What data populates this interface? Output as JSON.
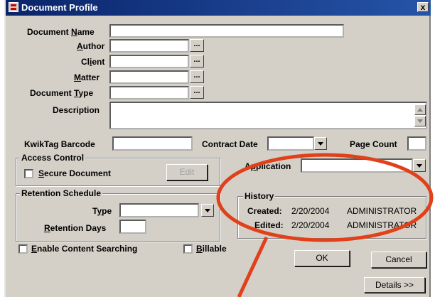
{
  "window": {
    "title": "Document Profile",
    "close_label": "x"
  },
  "form": {
    "document_name": {
      "label_pre": "Document ",
      "label_u": "N",
      "label_post": "ame",
      "value": ""
    },
    "author": {
      "label_pre": "",
      "label_u": "A",
      "label_post": "uthor",
      "value": "",
      "browse": "..."
    },
    "client": {
      "label_pre": "Cl",
      "label_u": "i",
      "label_post": "ent",
      "value": "",
      "browse": "..."
    },
    "matter": {
      "label_pre": "",
      "label_u": "M",
      "label_post": "atter",
      "value": "",
      "browse": "..."
    },
    "document_type": {
      "label_pre": "Document ",
      "label_u": "T",
      "label_post": "ype",
      "value": "",
      "browse": "..."
    },
    "description": {
      "label": "Description",
      "value": ""
    },
    "barcode": {
      "label": "KwikTag Barcode",
      "value": ""
    },
    "contract_date": {
      "label": "Contract Date",
      "value": ""
    },
    "page_count": {
      "label": "Page Count",
      "value": ""
    }
  },
  "access_control": {
    "legend": "Access Control",
    "secure_pre": "",
    "secure_u": "S",
    "secure_post": "ecure Document",
    "edit_label": "Edit"
  },
  "application": {
    "label_pre": "A",
    "label_u": "p",
    "label_post": "plication",
    "value": ""
  },
  "retention": {
    "legend": "Retention Schedule",
    "type_pre": "T",
    "type_u": "y",
    "type_post": "pe",
    "days_pre": "",
    "days_u": "R",
    "days_post": "etention Days",
    "type_value": "",
    "days_value": ""
  },
  "history": {
    "legend": "History",
    "created_label": "Created:",
    "created_date": "2/20/2004",
    "created_user": "ADMINISTRATOR",
    "edited_label": "Edited:",
    "edited_date": "2/20/2004",
    "edited_user": "ADMINISTRATOR"
  },
  "options": {
    "content_pre": "",
    "content_u": "E",
    "content_post": "nable Content Searching",
    "billable_pre": "",
    "billable_u": "B",
    "billable_post": "illable"
  },
  "buttons": {
    "ok": "OK",
    "cancel": "Cancel",
    "details": "Details >>"
  },
  "annotation": {
    "color": "#e0401a"
  }
}
